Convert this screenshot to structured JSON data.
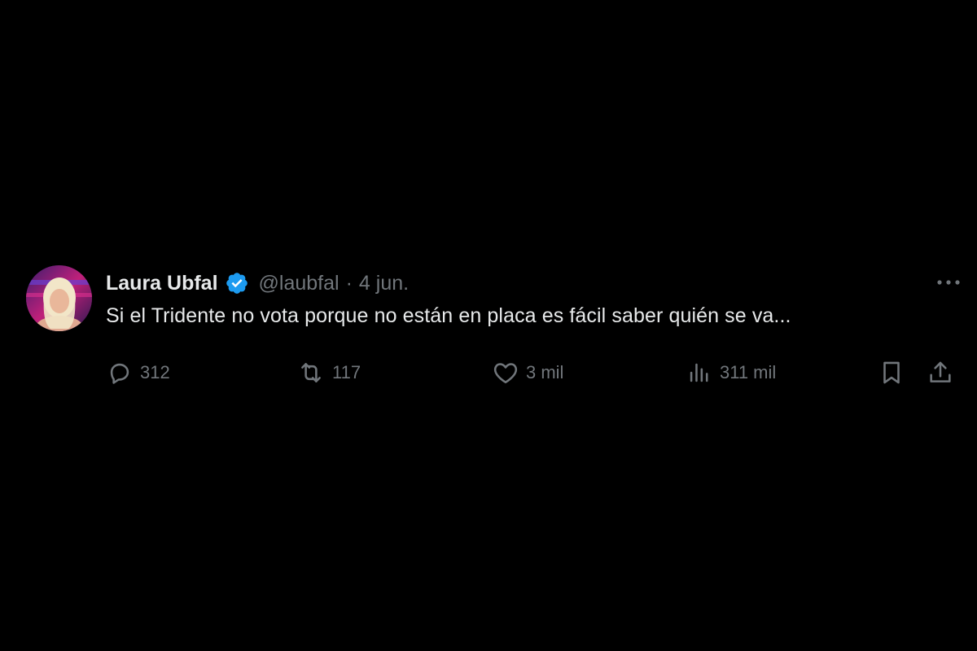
{
  "tweet": {
    "author": {
      "display_name": "Laura Ubfal",
      "handle": "@laubfal",
      "verified": true
    },
    "separator": "·",
    "date": "4 jun.",
    "text": "Si el Tridente no vota porque no están en placa es fácil saber quién se va...",
    "actions": {
      "replies": "312",
      "retweets": "117",
      "likes": "3 mil",
      "views": "311 mil"
    }
  },
  "icons": {
    "avatar": "avatar",
    "verified": "verified-badge-icon",
    "more": "more-icon",
    "reply": "reply-icon",
    "retweet": "retweet-icon",
    "like": "heart-icon",
    "views": "views-icon",
    "bookmark": "bookmark-icon",
    "share": "share-icon"
  },
  "colors": {
    "background": "#000000",
    "text_primary": "#e7e9ea",
    "text_secondary": "#71767b",
    "verified_blue": "#1d9bf0"
  }
}
